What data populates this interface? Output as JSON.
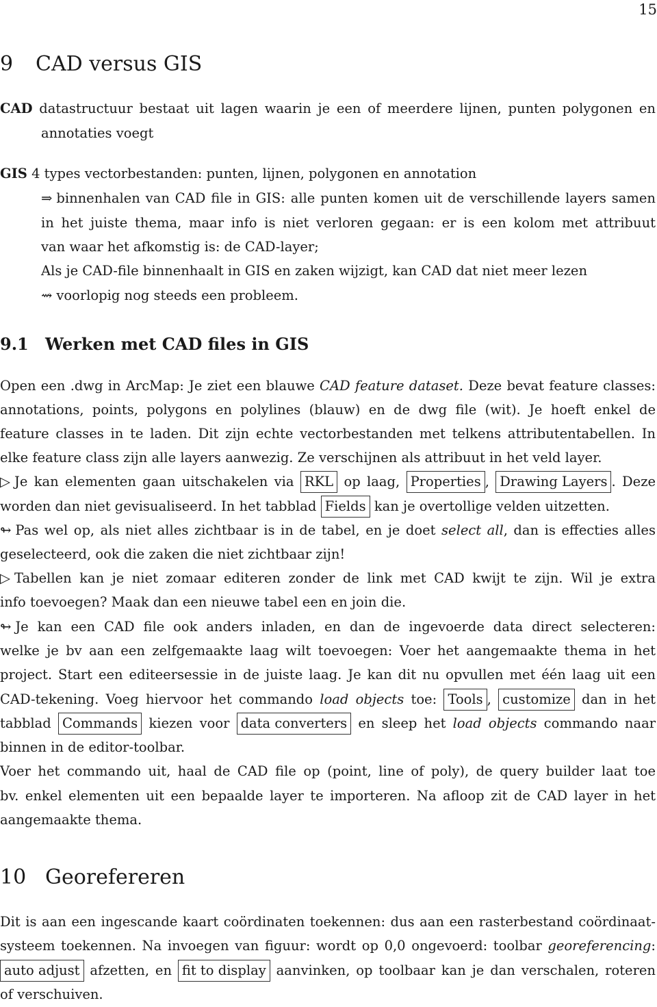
{
  "page_number": "15",
  "section9": {
    "number": "9",
    "title": "CAD versus GIS",
    "cad_term": "CAD",
    "cad_def_1": "datastructuur bestaat uit lagen waarin je een of meerdere lijnen, punten polygonen en",
    "cad_def_2": "annotaties voegt",
    "gis_term": "GIS",
    "gis_def_1": "4 types vectorbestanden: punten, lijnen, polygonen en annotation",
    "gis_line_2": "binnenhalen van CAD file in GIS: alle punten komen uit de verschillende layers samen",
    "gis_line_3": "in het juiste thema, maar info is niet verloren gegaan: er is een kolom met attribuut",
    "gis_line_4": "van waar het afkomstig is: de CAD-layer;",
    "gis_line_5": "Als je CAD-file binnenhaalt in GIS en zaken wijzigt, kan CAD dat niet meer lezen",
    "gis_line_6": "voorlopig nog steeds een probleem.",
    "arrow_implies": "⇒",
    "arrow_squiggle": "⇝"
  },
  "section9_1": {
    "number": "9.1",
    "title": "Werken met CAD files in GIS",
    "p1_l1_a": "Open een .dwg in ArcMap: Je ziet een blauwe ",
    "p1_l1_i": "CAD feature dataset.",
    "p1_l1_b": " Deze bevat feature classes:",
    "p1_l2": "annotations, points, polygons en polylines (blauw) en de dwg file (wit).  Je hoeft enkel de",
    "p1_l3": "feature classes in te laden. Dit zijn echte vectorbestanden met telkens attributentabellen. In",
    "p1_l4": "elke feature class zijn alle layers aanwezig. Ze verschijnen als attribuut in het veld layer.",
    "triangle": "▷",
    "hook": "↬",
    "p2_l1_a": "Je kan elementen gaan uitschakelen via",
    "box_rkl": "RKL",
    "p2_l1_b": "op laag,",
    "box_properties": "Properties",
    "box_drawing_layers": "Drawing Layers",
    "p2_l1_c": ". Deze",
    "p2_l2_a": "worden dan niet gevisualiseerd. In het tabblad",
    "box_fields": "Fields",
    "p2_l2_b": "kan je overtollige velden uitzetten.",
    "p3_l1_a": "Pas wel op, als niet alles zichtbaar is in de tabel, en je doet ",
    "p3_l1_i": "select all",
    "p3_l1_b": ", dan is effecties alles",
    "p3_l2": "geselecteerd, ook die zaken die niet zichtbaar zijn!",
    "p4_l1": "Tabellen kan je niet zomaar editeren zonder de link met CAD kwijt te zijn.  Wil je extra",
    "p4_l2": "info toevoegen? Maak dan een nieuwe tabel een en join die.",
    "p5_l1": "Je kan een CAD file ook anders inladen, en dan de ingevoerde data direct selecteren:",
    "p5_l2": "welke je bv aan een zelfgemaakte laag wilt toevoegen: Voer het aangemaakte thema in het",
    "p5_l3": "project. Start een editeersessie in de juiste laag. Je kan dit nu opvullen met één laag uit een",
    "p5_l4_a": "CAD-tekening. Voeg hiervoor het commando ",
    "p5_l4_i": "load objects",
    "p5_l4_b": " toe:",
    "box_tools": "Tools",
    "box_customize": "customize",
    "p5_l4_c": "dan in het",
    "p5_l5_a": "tabblad",
    "box_commands": "Commands",
    "p5_l5_b": "kiezen voor",
    "box_data_converters": "data converters",
    "p5_l5_c": "en sleep het ",
    "p5_l5_i": "load objects",
    "p5_l5_d": " commando naar",
    "p5_l6": "binnen in de editor-toolbar.",
    "p6_l1": "Voer het commando uit, haal de CAD file op (point, line of poly), de query builder laat toe",
    "p6_l2": "bv. enkel elementen uit een bepaalde layer te importeren. Na afloop zit de CAD layer in het",
    "p6_l3": "aangemaakte thema."
  },
  "section10": {
    "number": "10",
    "title": "Georefereren",
    "l1": "Dit is aan een ingescande kaart coördinaten toekennen: dus aan een rasterbestand coördinaat-",
    "l2_a": "systeem toekennen. Na invoegen van figuur: wordt op 0,0 ongevoerd: toolbar ",
    "l2_i": "georeferencing",
    "l2_b": ":",
    "box_auto_adjust": "auto adjust",
    "l3_a": "afzetten, en",
    "box_fit_to_display": "fit to display",
    "l3_b": "aanvinken, op toolbaar kan je dan verschalen, roteren",
    "l4": "of verschuiven."
  }
}
